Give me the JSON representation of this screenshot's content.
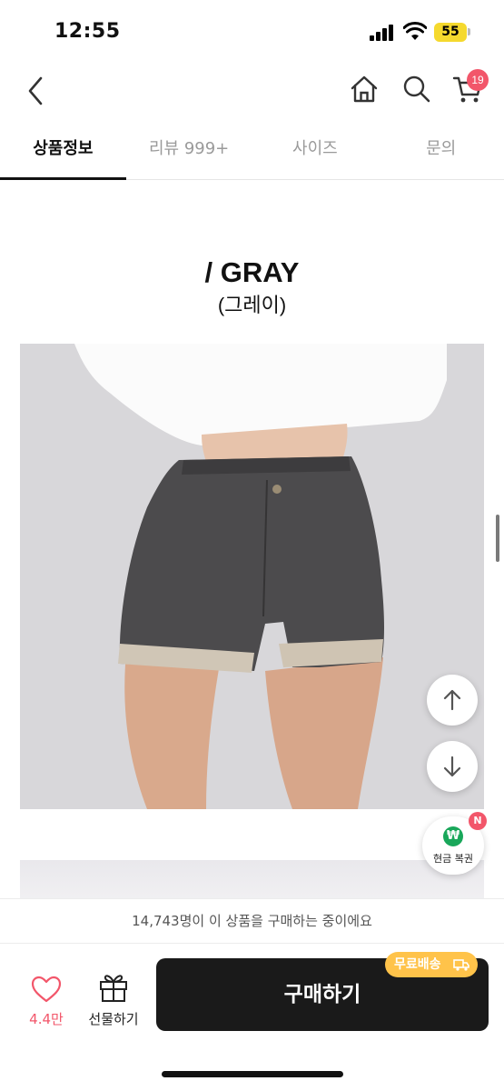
{
  "status": {
    "time": "12:55",
    "battery": "55"
  },
  "nav": {
    "cart_count": "19"
  },
  "tabs": [
    {
      "label": "상품정보"
    },
    {
      "label": "리뷰 999+"
    },
    {
      "label": "사이즈"
    },
    {
      "label": "문의"
    }
  ],
  "product": {
    "title": "/ GRAY",
    "subtitle": "(그레이)"
  },
  "cash": {
    "coin": "₩",
    "label": "현금 복권",
    "new_badge": "N"
  },
  "buyers": {
    "text": "14,743명이 이 상품을 구매하는 중이에요"
  },
  "bottom": {
    "like_count": "4.4만",
    "gift_label": "선물하기",
    "buy_label": "구매하기",
    "free_shipping": "무료배송"
  },
  "colors": {
    "accent": "#f2566a",
    "buy_button": "#1a1a1a",
    "free_badge": "#ffc34a",
    "cash_green": "#19a75a"
  }
}
